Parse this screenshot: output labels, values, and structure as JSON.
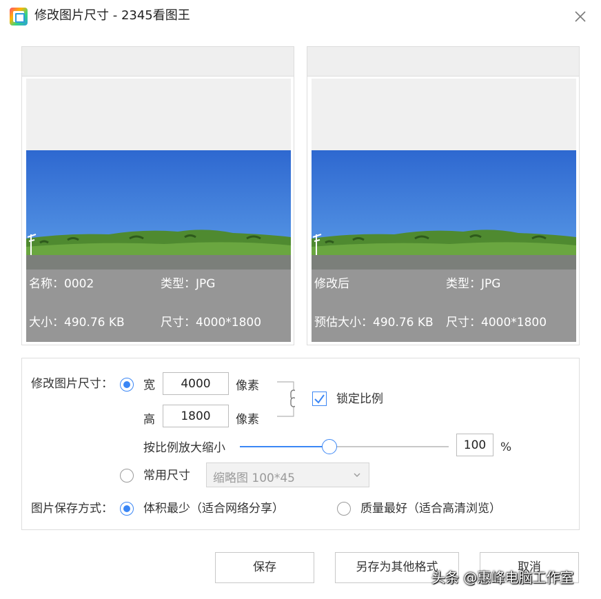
{
  "window": {
    "title": "修改图片尺寸 - 2345看图王"
  },
  "preview_original": {
    "name": "名称：0002",
    "type": "类型：JPG",
    "size": "大小：490.76 KB",
    "dimensions": "尺寸：4000*1800"
  },
  "preview_modified": {
    "caption": "修改后",
    "type": "类型：JPG",
    "estimated_size": "预估大小：490.76 KB",
    "dimensions": "尺寸：4000*1800"
  },
  "resize": {
    "label": "修改图片尺寸：",
    "width_label": "宽",
    "width_value": "4000",
    "height_label": "高",
    "height_value": "1800",
    "unit": "像素",
    "lock_ratio_label": "锁定比例",
    "lock_ratio_checked": true,
    "scale_label": "按比例放大缩小",
    "scale_value": "100",
    "scale_percent": 0.43,
    "scale_unit": "%",
    "preset_label": "常用尺寸",
    "preset_value": "缩略图 100*45"
  },
  "save_mode": {
    "label": "图片保存方式：",
    "option_small": "体积最少（适合网络分享）",
    "option_quality": "质量最好（适合高清浏览）"
  },
  "buttons": {
    "save": "保存",
    "save_as": "另存为其他格式",
    "cancel": "取消"
  },
  "watermark": "头条 @惠峰电脑工作室",
  "colors": {
    "accent": "#3a86f5",
    "info_overlay": "#969696",
    "sky": "#2f6fd6",
    "grass": "#5f9a3a"
  }
}
